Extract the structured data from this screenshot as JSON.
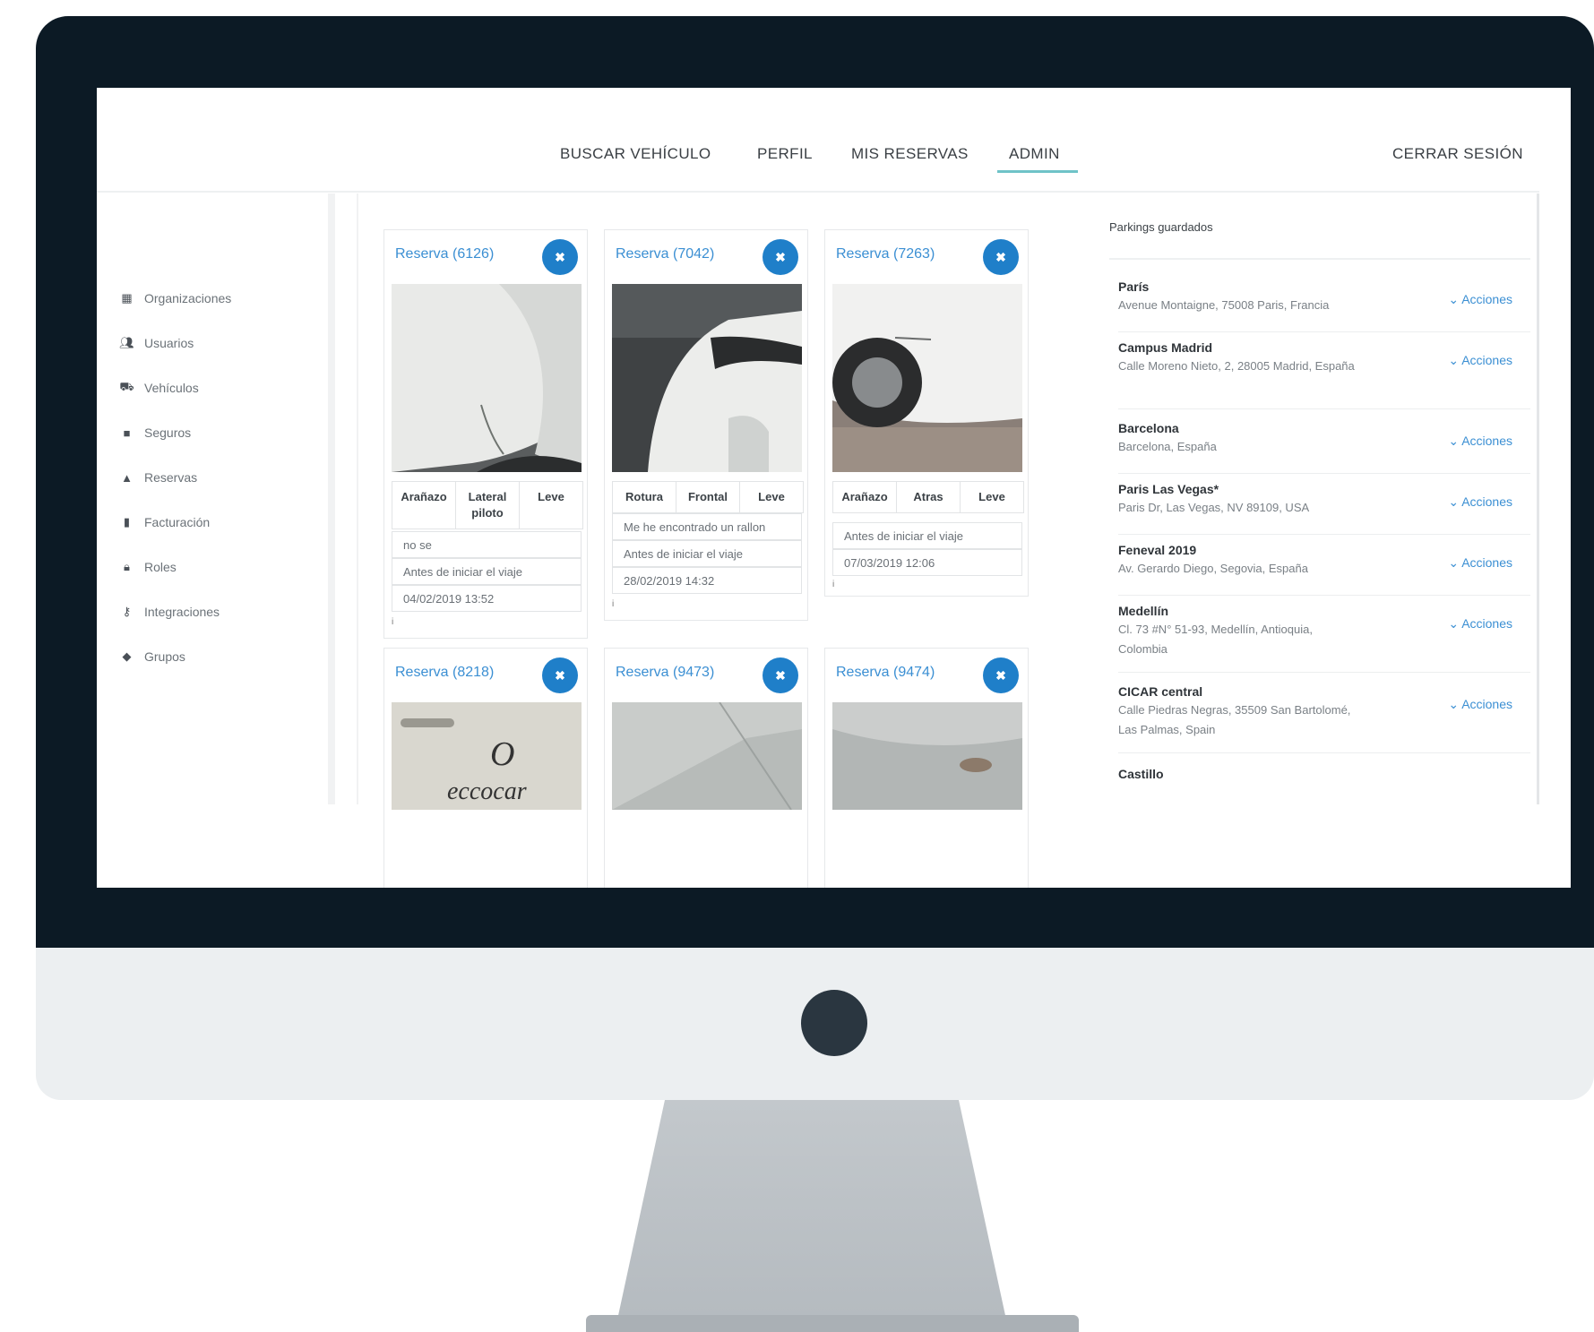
{
  "nav": {
    "items": [
      "BUSCAR VEHÍCULO",
      "PERFIL",
      "MIS RESERVAS",
      "ADMIN"
    ],
    "active": "ADMIN",
    "logout": "CERRAR SESIÓN"
  },
  "sidebar": {
    "items": [
      {
        "label": "Organizaciones",
        "icon": "building-icon"
      },
      {
        "label": "Usuarios",
        "icon": "users-icon"
      },
      {
        "label": "Vehículos",
        "icon": "car-icon"
      },
      {
        "label": "Seguros",
        "icon": "shield-icon"
      },
      {
        "label": "Reservas",
        "icon": "binoculars-icon"
      },
      {
        "label": "Facturación",
        "icon": "file-icon"
      },
      {
        "label": "Roles",
        "icon": "lock-icon"
      },
      {
        "label": "Integraciones",
        "icon": "key-icon"
      },
      {
        "label": "Grupos",
        "icon": "tag-icon"
      }
    ]
  },
  "cards": [
    {
      "title": "Reserva (6126)",
      "tags": [
        "Arañazo",
        "Lateral piloto",
        "Leve"
      ],
      "note": "no se",
      "moment": "Antes de iniciar el viaje",
      "date": "04/02/2019 13:52"
    },
    {
      "title": "Reserva (7042)",
      "tags": [
        "Rotura",
        "Frontal",
        "Leve"
      ],
      "note": "Me he encontrado un rallon",
      "moment": "Antes de iniciar el viaje",
      "date": "28/02/2019 14:32"
    },
    {
      "title": "Reserva (7263)",
      "tags": [
        "Arañazo",
        "Atras",
        "Leve"
      ],
      "note": "",
      "moment": "Antes de iniciar el viaje",
      "date": "07/03/2019 12:06"
    },
    {
      "title": "Reserva (8218)",
      "photo_text": "eccocar"
    },
    {
      "title": "Reserva (9473)"
    },
    {
      "title": "Reserva (9474)"
    }
  ],
  "parkings": {
    "title": "Parkings guardados",
    "actions_label": "Acciones",
    "items": [
      {
        "name": "París",
        "address": "Avenue Montaigne, 75008 Paris, Francia"
      },
      {
        "name": "Campus Madrid",
        "address": "Calle Moreno Nieto, 2, 28005 Madrid, España"
      },
      {
        "name": "Barcelona",
        "address": "Barcelona, España"
      },
      {
        "name": "Paris Las Vegas*",
        "address": "Paris Dr, Las Vegas, NV 89109, USA"
      },
      {
        "name": "Feneval 2019",
        "address": "Av. Gerardo Diego, Segovia, España"
      },
      {
        "name": "Medellín",
        "address": "Cl. 73 #N° 51-93, Medellín, Antioquia, Colombia"
      },
      {
        "name": "CICAR central",
        "address": "Calle Piedras Negras, 35509 San Bartolomé, Las Palmas, Spain"
      },
      {
        "name": "Castillo",
        "address": ""
      }
    ]
  },
  "colors": {
    "accent": "#3b8fd3",
    "button": "#1f7fc9",
    "bezel": "#0c1a25",
    "nav_underline": "#6fc3c8"
  }
}
